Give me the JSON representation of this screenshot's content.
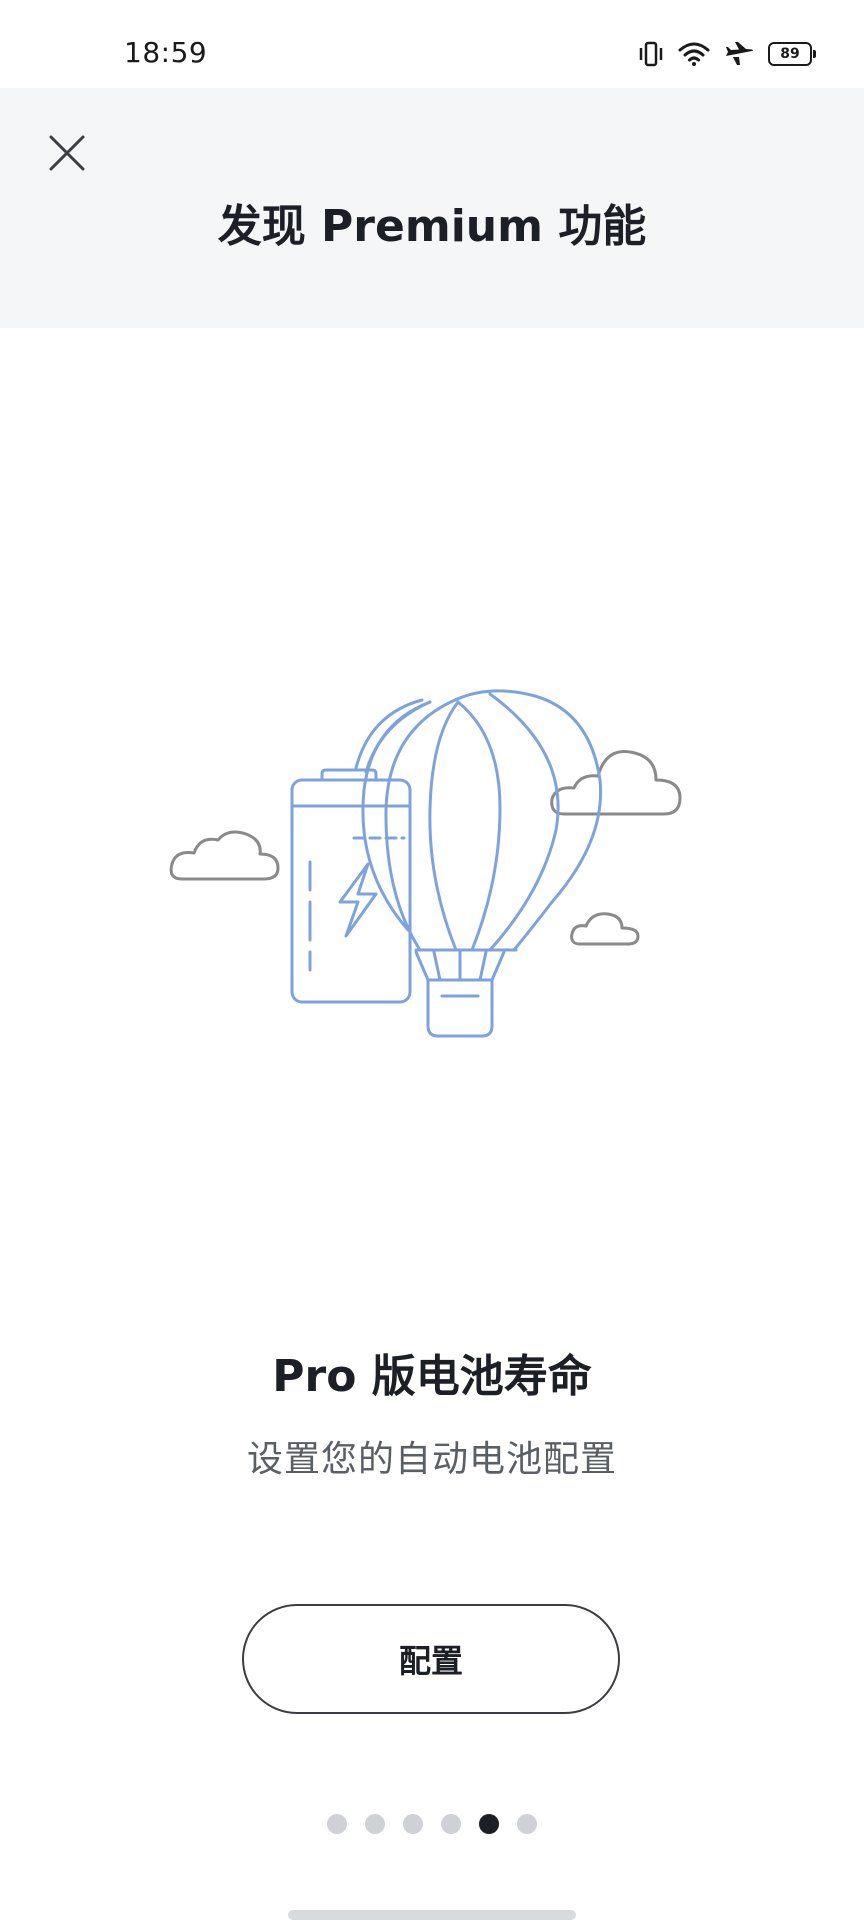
{
  "status_bar": {
    "time": "18:59",
    "battery_level": "89",
    "icons": [
      "vibrate-icon",
      "wifi-icon",
      "airplane-icon",
      "battery-icon"
    ]
  },
  "header": {
    "title": "发现 Premium 功能",
    "close_icon": "close-icon"
  },
  "feature": {
    "title": "Pro 版电池寿命",
    "subtitle": "设置您的自动电池配置",
    "illustration": "battery-balloon-illustration"
  },
  "actions": {
    "config_label": "配置"
  },
  "pager": {
    "total": 6,
    "active_index": 4
  },
  "colors": {
    "accent_line": "#7ea3dc",
    "cloud_line": "#8a8a8a",
    "header_bg": "#f5f6f8"
  }
}
